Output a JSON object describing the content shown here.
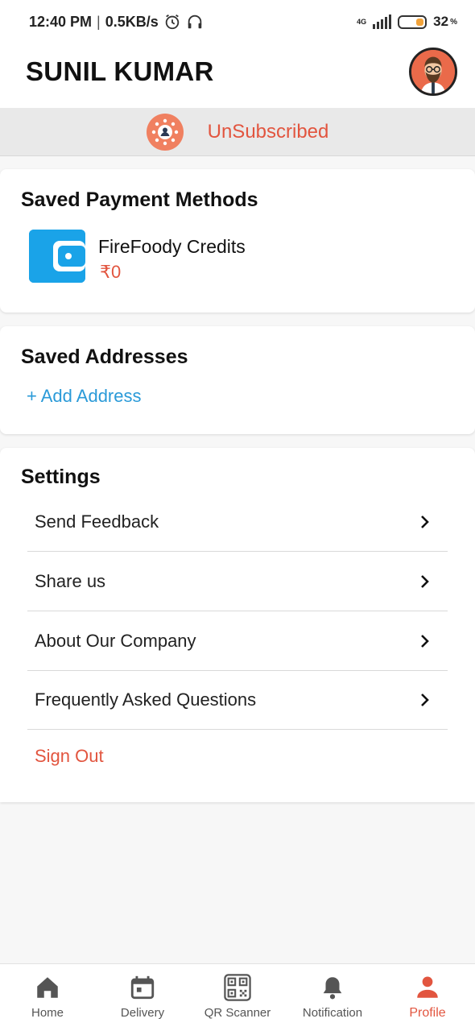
{
  "status_bar": {
    "time": "12:40 PM",
    "speed": "0.5KB/s",
    "network": "4G",
    "battery": "32",
    "battery_unit": "%"
  },
  "header": {
    "user_name": "SUNIL KUMAR"
  },
  "subscription": {
    "status": "UnSubscribed"
  },
  "payment": {
    "title": "Saved Payment Methods",
    "method_name": "FireFoody Credits",
    "amount": "₹0"
  },
  "addresses": {
    "title": "Saved Addresses",
    "add_label": "+ Add Address"
  },
  "settings": {
    "title": "Settings",
    "items": [
      {
        "label": "Send Feedback"
      },
      {
        "label": "Share us"
      },
      {
        "label": "About Our Company"
      },
      {
        "label": "Frequently Asked Questions"
      }
    ],
    "sign_out": "Sign Out"
  },
  "nav": {
    "items": [
      {
        "label": "Home",
        "icon": "home-icon"
      },
      {
        "label": "Delivery",
        "icon": "calendar-icon"
      },
      {
        "label": "QR Scanner",
        "icon": "qr-code-icon"
      },
      {
        "label": "Notification",
        "icon": "bell-icon"
      },
      {
        "label": "Profile",
        "icon": "person-icon"
      }
    ],
    "active": "Profile"
  },
  "colors": {
    "accent": "#e2553f",
    "link": "#2a9ad8",
    "wallet": "#1aa3e8"
  }
}
